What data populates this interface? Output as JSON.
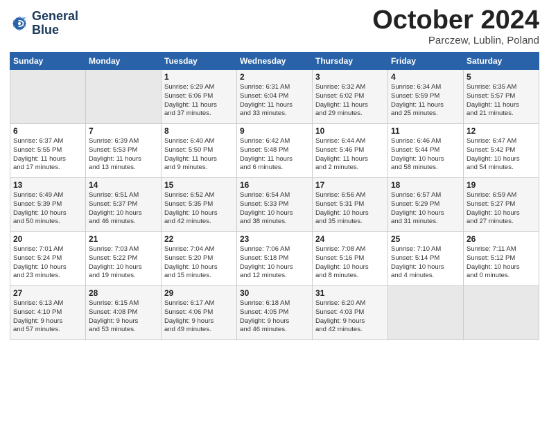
{
  "logo": {
    "line1": "General",
    "line2": "Blue"
  },
  "title": "October 2024",
  "location": "Parczew, Lublin, Poland",
  "weekdays": [
    "Sunday",
    "Monday",
    "Tuesday",
    "Wednesday",
    "Thursday",
    "Friday",
    "Saturday"
  ],
  "weeks": [
    [
      {
        "day": "",
        "text": ""
      },
      {
        "day": "",
        "text": ""
      },
      {
        "day": "1",
        "text": "Sunrise: 6:29 AM\nSunset: 6:06 PM\nDaylight: 11 hours\nand 37 minutes."
      },
      {
        "day": "2",
        "text": "Sunrise: 6:31 AM\nSunset: 6:04 PM\nDaylight: 11 hours\nand 33 minutes."
      },
      {
        "day": "3",
        "text": "Sunrise: 6:32 AM\nSunset: 6:02 PM\nDaylight: 11 hours\nand 29 minutes."
      },
      {
        "day": "4",
        "text": "Sunrise: 6:34 AM\nSunset: 5:59 PM\nDaylight: 11 hours\nand 25 minutes."
      },
      {
        "day": "5",
        "text": "Sunrise: 6:35 AM\nSunset: 5:57 PM\nDaylight: 11 hours\nand 21 minutes."
      }
    ],
    [
      {
        "day": "6",
        "text": "Sunrise: 6:37 AM\nSunset: 5:55 PM\nDaylight: 11 hours\nand 17 minutes."
      },
      {
        "day": "7",
        "text": "Sunrise: 6:39 AM\nSunset: 5:53 PM\nDaylight: 11 hours\nand 13 minutes."
      },
      {
        "day": "8",
        "text": "Sunrise: 6:40 AM\nSunset: 5:50 PM\nDaylight: 11 hours\nand 9 minutes."
      },
      {
        "day": "9",
        "text": "Sunrise: 6:42 AM\nSunset: 5:48 PM\nDaylight: 11 hours\nand 6 minutes."
      },
      {
        "day": "10",
        "text": "Sunrise: 6:44 AM\nSunset: 5:46 PM\nDaylight: 11 hours\nand 2 minutes."
      },
      {
        "day": "11",
        "text": "Sunrise: 6:46 AM\nSunset: 5:44 PM\nDaylight: 10 hours\nand 58 minutes."
      },
      {
        "day": "12",
        "text": "Sunrise: 6:47 AM\nSunset: 5:42 PM\nDaylight: 10 hours\nand 54 minutes."
      }
    ],
    [
      {
        "day": "13",
        "text": "Sunrise: 6:49 AM\nSunset: 5:39 PM\nDaylight: 10 hours\nand 50 minutes."
      },
      {
        "day": "14",
        "text": "Sunrise: 6:51 AM\nSunset: 5:37 PM\nDaylight: 10 hours\nand 46 minutes."
      },
      {
        "day": "15",
        "text": "Sunrise: 6:52 AM\nSunset: 5:35 PM\nDaylight: 10 hours\nand 42 minutes."
      },
      {
        "day": "16",
        "text": "Sunrise: 6:54 AM\nSunset: 5:33 PM\nDaylight: 10 hours\nand 38 minutes."
      },
      {
        "day": "17",
        "text": "Sunrise: 6:56 AM\nSunset: 5:31 PM\nDaylight: 10 hours\nand 35 minutes."
      },
      {
        "day": "18",
        "text": "Sunrise: 6:57 AM\nSunset: 5:29 PM\nDaylight: 10 hours\nand 31 minutes."
      },
      {
        "day": "19",
        "text": "Sunrise: 6:59 AM\nSunset: 5:27 PM\nDaylight: 10 hours\nand 27 minutes."
      }
    ],
    [
      {
        "day": "20",
        "text": "Sunrise: 7:01 AM\nSunset: 5:24 PM\nDaylight: 10 hours\nand 23 minutes."
      },
      {
        "day": "21",
        "text": "Sunrise: 7:03 AM\nSunset: 5:22 PM\nDaylight: 10 hours\nand 19 minutes."
      },
      {
        "day": "22",
        "text": "Sunrise: 7:04 AM\nSunset: 5:20 PM\nDaylight: 10 hours\nand 15 minutes."
      },
      {
        "day": "23",
        "text": "Sunrise: 7:06 AM\nSunset: 5:18 PM\nDaylight: 10 hours\nand 12 minutes."
      },
      {
        "day": "24",
        "text": "Sunrise: 7:08 AM\nSunset: 5:16 PM\nDaylight: 10 hours\nand 8 minutes."
      },
      {
        "day": "25",
        "text": "Sunrise: 7:10 AM\nSunset: 5:14 PM\nDaylight: 10 hours\nand 4 minutes."
      },
      {
        "day": "26",
        "text": "Sunrise: 7:11 AM\nSunset: 5:12 PM\nDaylight: 10 hours\nand 0 minutes."
      }
    ],
    [
      {
        "day": "27",
        "text": "Sunrise: 6:13 AM\nSunset: 4:10 PM\nDaylight: 9 hours\nand 57 minutes."
      },
      {
        "day": "28",
        "text": "Sunrise: 6:15 AM\nSunset: 4:08 PM\nDaylight: 9 hours\nand 53 minutes."
      },
      {
        "day": "29",
        "text": "Sunrise: 6:17 AM\nSunset: 4:06 PM\nDaylight: 9 hours\nand 49 minutes."
      },
      {
        "day": "30",
        "text": "Sunrise: 6:18 AM\nSunset: 4:05 PM\nDaylight: 9 hours\nand 46 minutes."
      },
      {
        "day": "31",
        "text": "Sunrise: 6:20 AM\nSunset: 4:03 PM\nDaylight: 9 hours\nand 42 minutes."
      },
      {
        "day": "",
        "text": ""
      },
      {
        "day": "",
        "text": ""
      }
    ]
  ]
}
